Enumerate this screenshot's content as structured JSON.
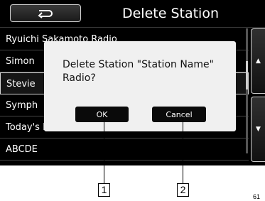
{
  "header": {
    "title": "Delete Station",
    "back_icon": "return-arrow-icon"
  },
  "stations": [
    {
      "name": "Ryuichi Sakamoto Radio"
    },
    {
      "name": "Simon"
    },
    {
      "name": "Stevie"
    },
    {
      "name": "Symph"
    },
    {
      "name": "Today's Hits Radio"
    },
    {
      "name": "ABCDE"
    }
  ],
  "side_buttons": {
    "up_icon": "triangle-up-icon",
    "down_icon": "triangle-down-icon"
  },
  "dialog": {
    "message": "Delete Station \"Station Name\" Radio?",
    "ok_label": "OK",
    "cancel_label": "Cancel"
  },
  "callouts": [
    {
      "label": "1"
    },
    {
      "label": "2"
    }
  ],
  "corner_text": "61"
}
